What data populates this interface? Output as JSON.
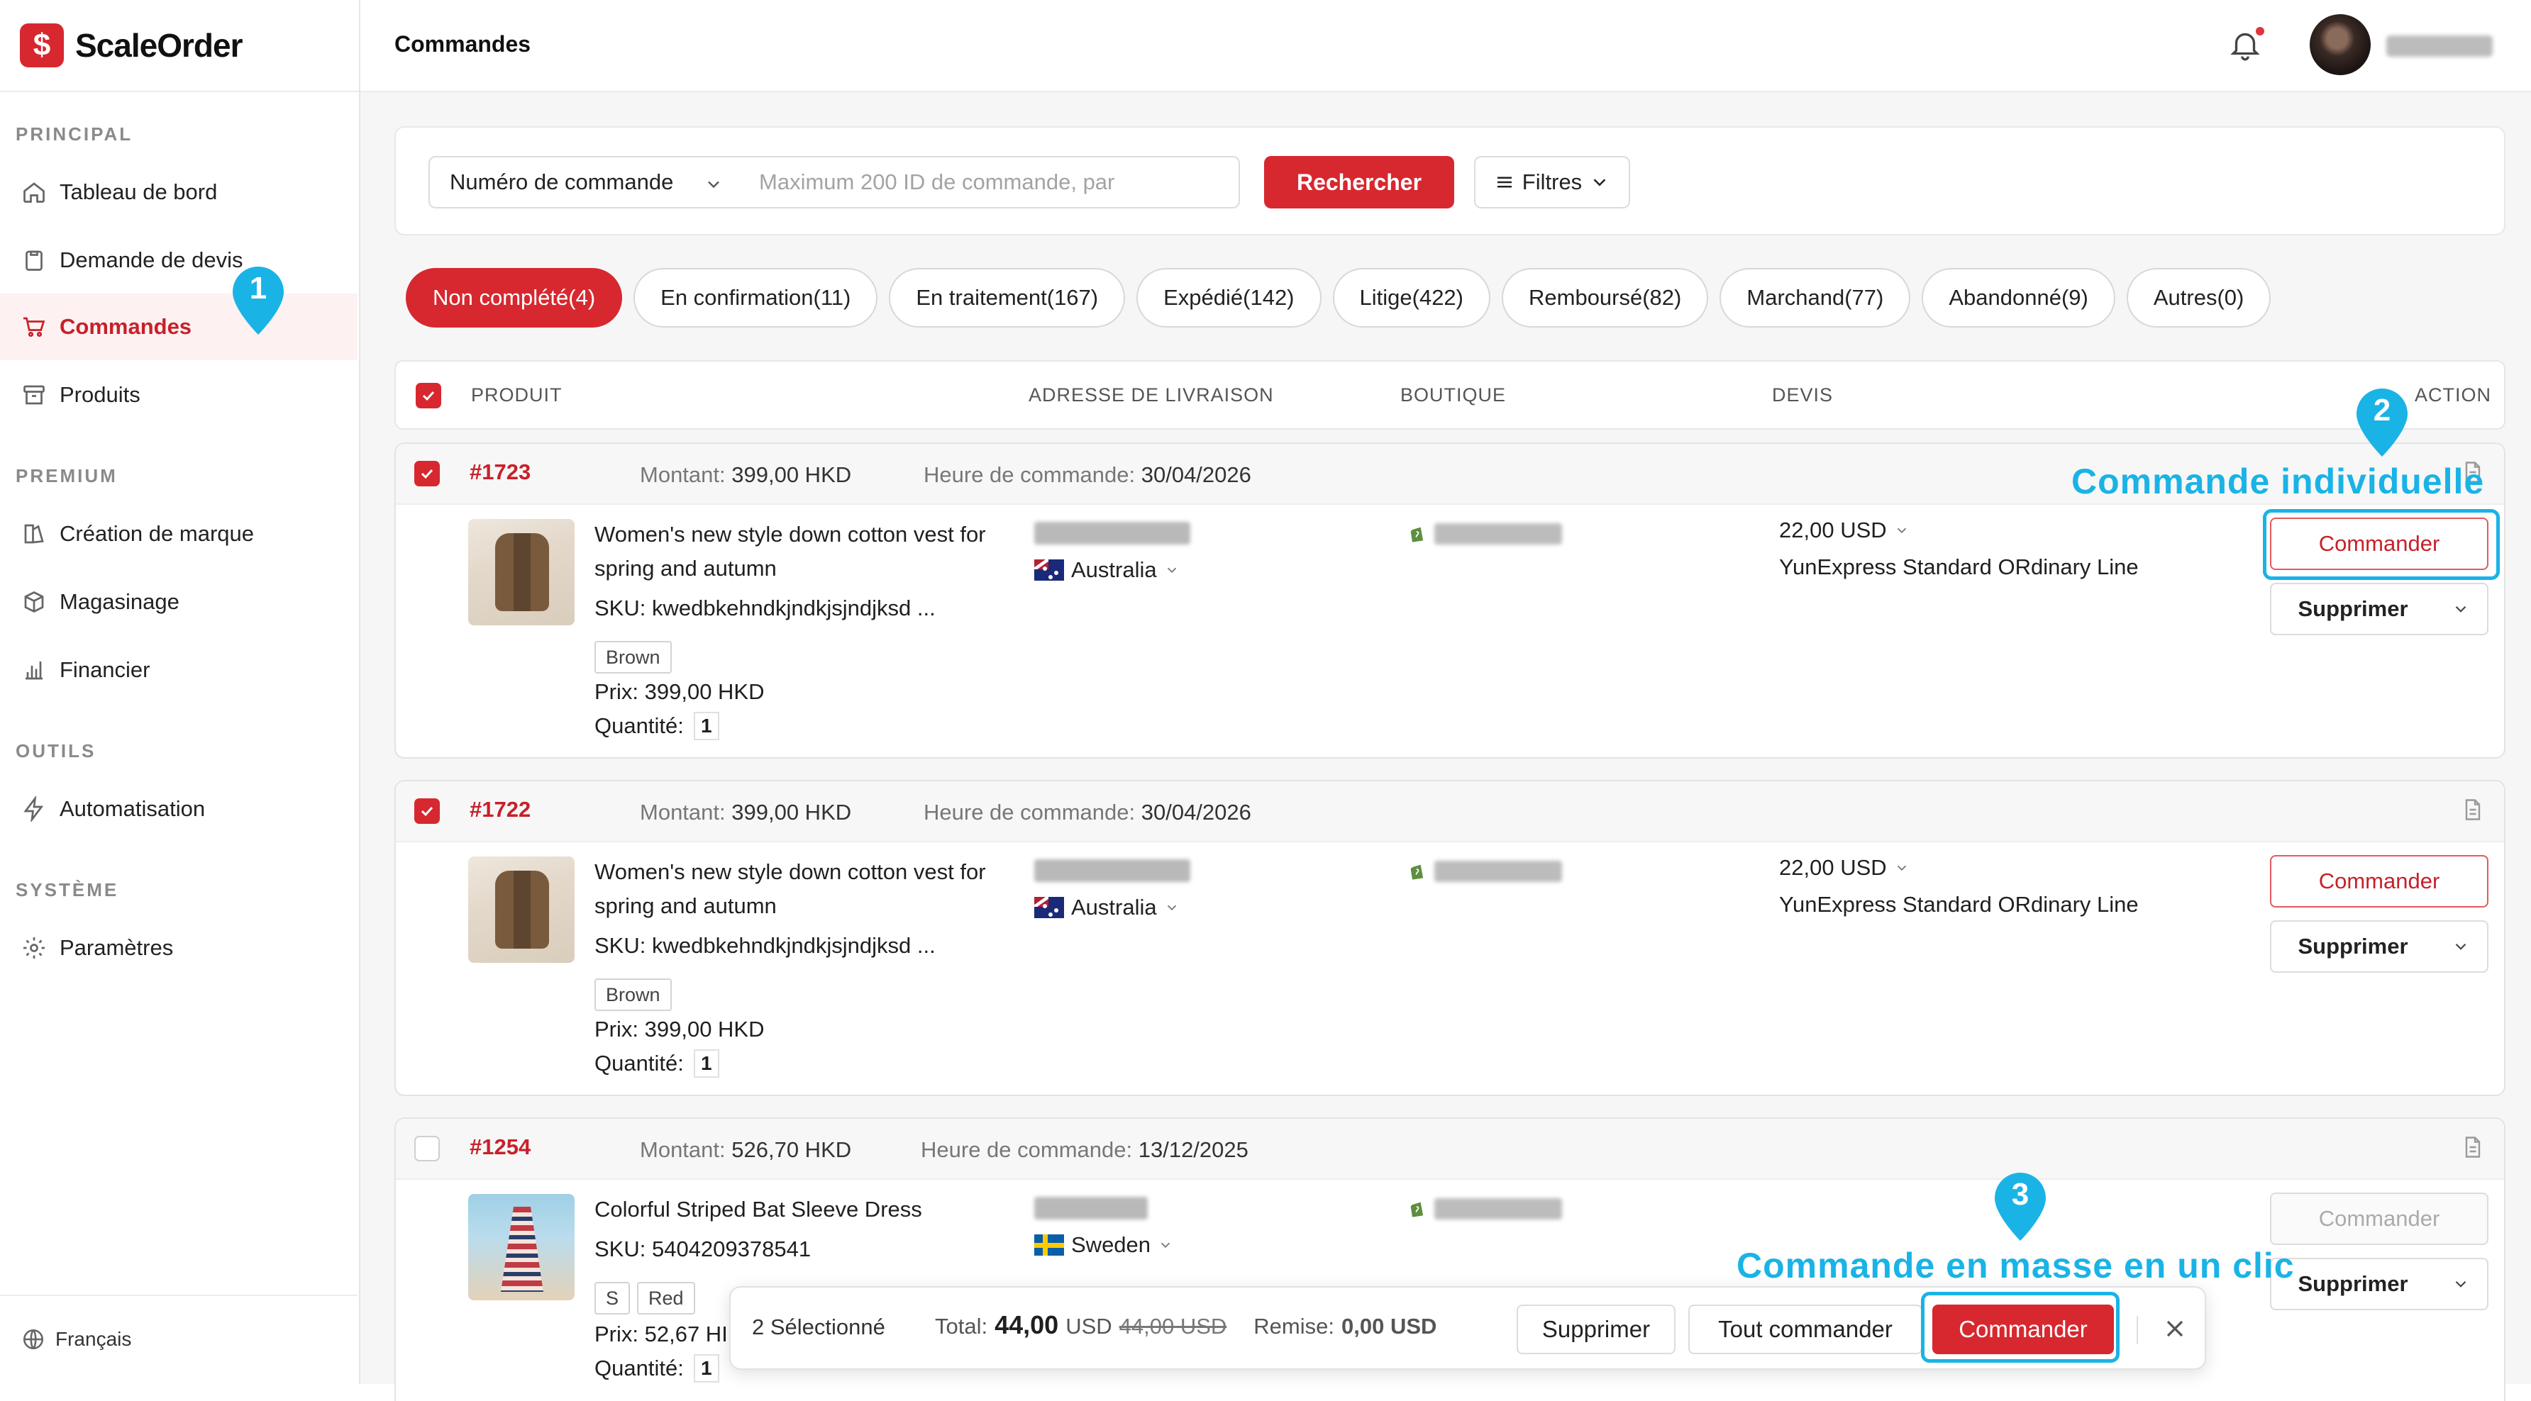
{
  "app": {
    "name": "ScaleOrder",
    "logo_glyph": "$",
    "brand_color": "#d7282f",
    "highlight_color": "#1ab3e6"
  },
  "header": {
    "title": "Commandes"
  },
  "sidebar": {
    "sections": {
      "principal": "PRINCIPAL",
      "premium": "PREMIUM",
      "outils": "OUTILS",
      "systeme": "SYSTÈME"
    },
    "items": [
      {
        "label": "Tableau de bord",
        "icon": "home-icon"
      },
      {
        "label": "Demande de devis",
        "icon": "clipboard-icon"
      },
      {
        "label": "Commandes",
        "icon": "cart-icon",
        "active": true
      },
      {
        "label": "Produits",
        "icon": "box-icon"
      },
      {
        "label": "Création de marque",
        "icon": "brand-icon"
      },
      {
        "label": "Magasinage",
        "icon": "package-icon"
      },
      {
        "label": "Financier",
        "icon": "bar-chart-icon"
      },
      {
        "label": "Automatisation",
        "icon": "lightning-icon"
      },
      {
        "label": "Paramètres",
        "icon": "gear-icon"
      }
    ],
    "language": "Français"
  },
  "search": {
    "field_select": "Numéro de commande",
    "placeholder": "Maximum 200 ID de commande, par",
    "search_button": "Rechercher",
    "filter_button": "Filtres"
  },
  "tabs": [
    {
      "label": "Non complété(4)",
      "active": true
    },
    {
      "label": "En confirmation(11)"
    },
    {
      "label": "En traitement(167)"
    },
    {
      "label": "Expédié(142)"
    },
    {
      "label": "Litige(422)"
    },
    {
      "label": "Remboursé(82)"
    },
    {
      "label": "Marchand(77)"
    },
    {
      "label": "Abandonné(9)"
    },
    {
      "label": "Autres(0)"
    }
  ],
  "table_headers": {
    "product": "PRODUIT",
    "address": "ADRESSE DE LIVRAISON",
    "shop": "BOUTIQUE",
    "quote": "DEVIS",
    "action": "ACTION"
  },
  "orders": [
    {
      "id": "#1723",
      "checked": true,
      "amount_label": "Montant:",
      "amount": "399,00 HKD",
      "time_label": "Heure de commande:",
      "time": "30/04/2026",
      "title": "Women's new style down cotton vest for spring and autumn",
      "sku": "SKU: kwedbkehndkjndkjsjndjksd ...",
      "variants": [
        "Brown"
      ],
      "price": "Prix: 399,00 HKD",
      "qty_label": "Quantité:",
      "qty": "1",
      "country": "Australia",
      "quote_price": "22,00 USD",
      "shipping": "YunExpress Standard ORdinary Line",
      "order_button": "Commander",
      "delete_button": "Supprimer"
    },
    {
      "id": "#1722",
      "checked": true,
      "amount_label": "Montant:",
      "amount": "399,00 HKD",
      "time_label": "Heure de commande:",
      "time": "30/04/2026",
      "title": "Women's new style down cotton vest for spring and autumn",
      "sku": "SKU: kwedbkehndkjndkjsjndjksd ...",
      "variants": [
        "Brown"
      ],
      "price": "Prix: 399,00 HKD",
      "qty_label": "Quantité:",
      "qty": "1",
      "country": "Australia",
      "quote_price": "22,00 USD",
      "shipping": "YunExpress Standard ORdinary Line",
      "order_button": "Commander",
      "delete_button": "Supprimer"
    },
    {
      "id": "#1254",
      "checked": false,
      "amount_label": "Montant:",
      "amount": "526,70 HKD",
      "time_label": "Heure de commande:",
      "time": "13/12/2025",
      "title": "Colorful Striped Bat Sleeve Dress",
      "sku": "SKU: 5404209378541",
      "variants": [
        "S",
        "Red"
      ],
      "price": "Prix: 52,67 HI",
      "qty_label": "Quantité:",
      "qty": "1",
      "country": "Sweden",
      "order_button": "Commander",
      "delete_button": "Supprimer"
    }
  ],
  "annotations": {
    "marker1": "1",
    "marker2": "2",
    "marker3": "3",
    "individual": "Commande individuelle",
    "bulk": "Commande en masse en un clic"
  },
  "bulk_bar": {
    "selected": "2 Sélectionné",
    "total_label": "Total:",
    "total": "44,00",
    "currency": "USD",
    "original": "44,00 USD",
    "discount_label": "Remise:",
    "discount": "0,00 USD",
    "delete": "Supprimer",
    "order_all": "Tout commander",
    "order": "Commander"
  }
}
